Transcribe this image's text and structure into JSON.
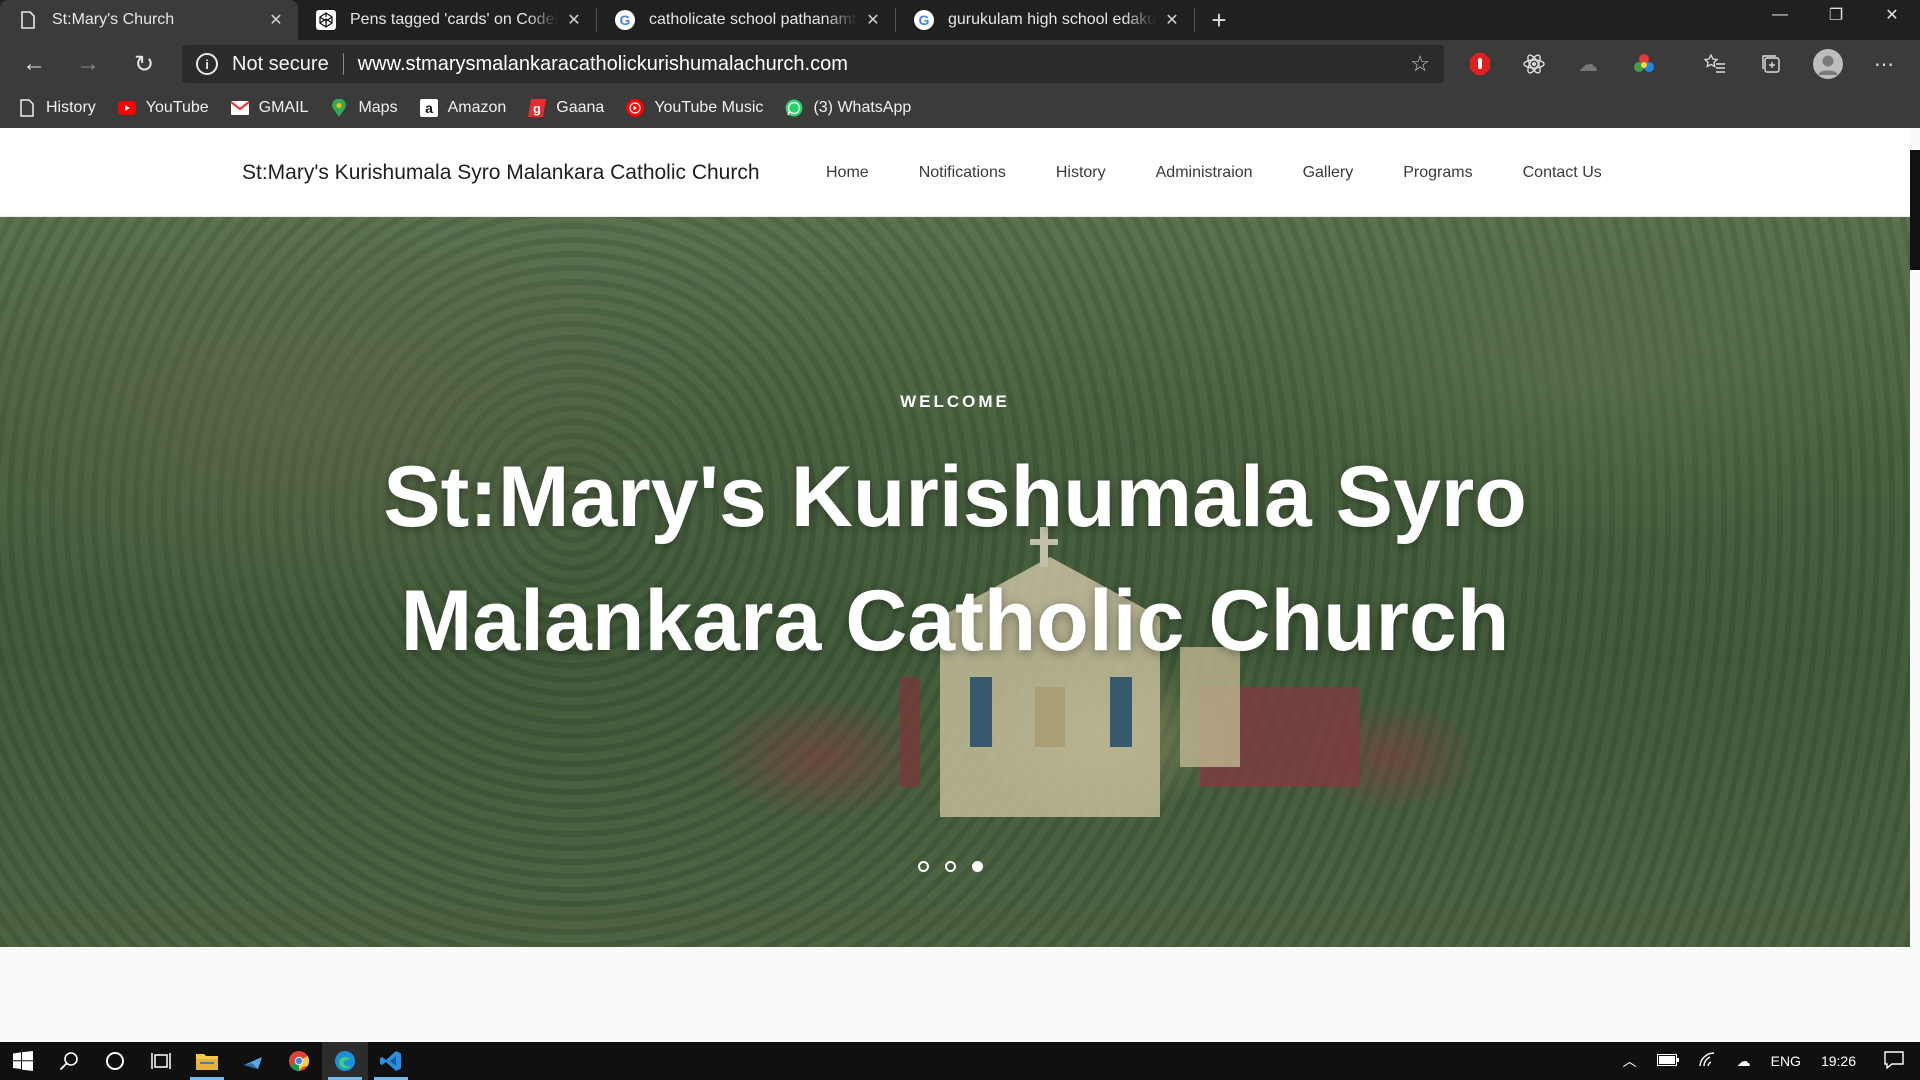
{
  "tabs": [
    {
      "title": "St:Mary's Church",
      "active": true
    },
    {
      "title": "Pens tagged 'cards' on CodePen",
      "active": false
    },
    {
      "title": "catholicate school pathanamthitta",
      "active": false
    },
    {
      "title": "gurukulam high school edakulam",
      "active": false
    }
  ],
  "address": {
    "security_label": "Not secure",
    "url": "www.stmarysmalankaracatholickurishumalachurch.com"
  },
  "bookmarks": [
    {
      "label": "History",
      "icon": "page-icon"
    },
    {
      "label": "YouTube",
      "icon": "youtube-icon"
    },
    {
      "label": "GMAIL",
      "icon": "gmail-icon"
    },
    {
      "label": "Maps",
      "icon": "maps-icon"
    },
    {
      "label": "Amazon",
      "icon": "amazon-icon"
    },
    {
      "label": "Gaana",
      "icon": "gaana-icon"
    },
    {
      "label": "YouTube Music",
      "icon": "youtube-music-icon"
    },
    {
      "label": "(3) WhatsApp",
      "icon": "whatsapp-icon"
    }
  ],
  "site": {
    "brand": "St:Mary's Kurishumala Syro Malankara Catholic Church",
    "menu": [
      "Home",
      "Notifications",
      "History",
      "Administraion",
      "Gallery",
      "Programs",
      "Contact Us"
    ]
  },
  "hero": {
    "kicker": "WELCOME",
    "title_line1": "St:Mary's Kurishumala Syro",
    "title_line2": "Malankara Catholic Church",
    "slides": 3,
    "active_slide": 3
  },
  "taskbar": {
    "language": "ENG",
    "time": "19:26"
  },
  "colors": {
    "tabbar_bg": "#202020",
    "toolbar_bg": "#3b3b3b",
    "taskbar_bg": "#101010",
    "accent": "#76b9ed"
  }
}
